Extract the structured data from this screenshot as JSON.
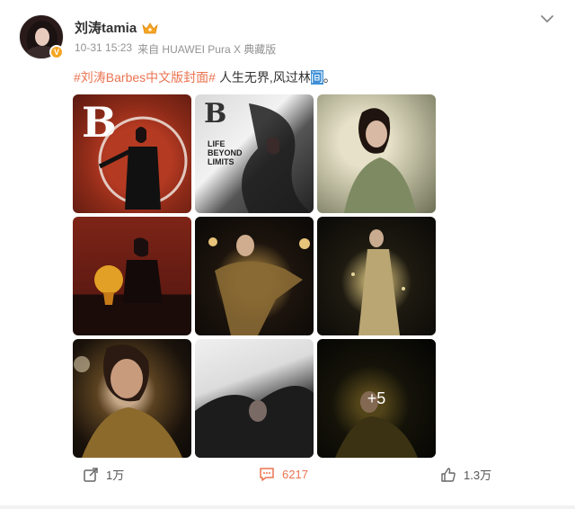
{
  "user": {
    "name": "刘涛tamia",
    "badge": "V"
  },
  "meta": {
    "time": "10-31 15:23",
    "source": "来自 HUAWEI Pura X 典藏版"
  },
  "post": {
    "hashtag": "#刘涛Barbes中文版封面#",
    "text_before": "人生无界,风过林",
    "text_highlight": "间",
    "text_after": "。"
  },
  "images": {
    "tile1_letter": "B",
    "tile2_letter": "B",
    "tile2_cover_text": "LIFE BEYOND LIMITS",
    "more_count": "+5"
  },
  "actions": {
    "share_count": "1万",
    "comment_count": "6217",
    "like_count": "1.3万"
  },
  "colors": {
    "accent": "#eb7350",
    "highlight": "#3d8fd6"
  }
}
